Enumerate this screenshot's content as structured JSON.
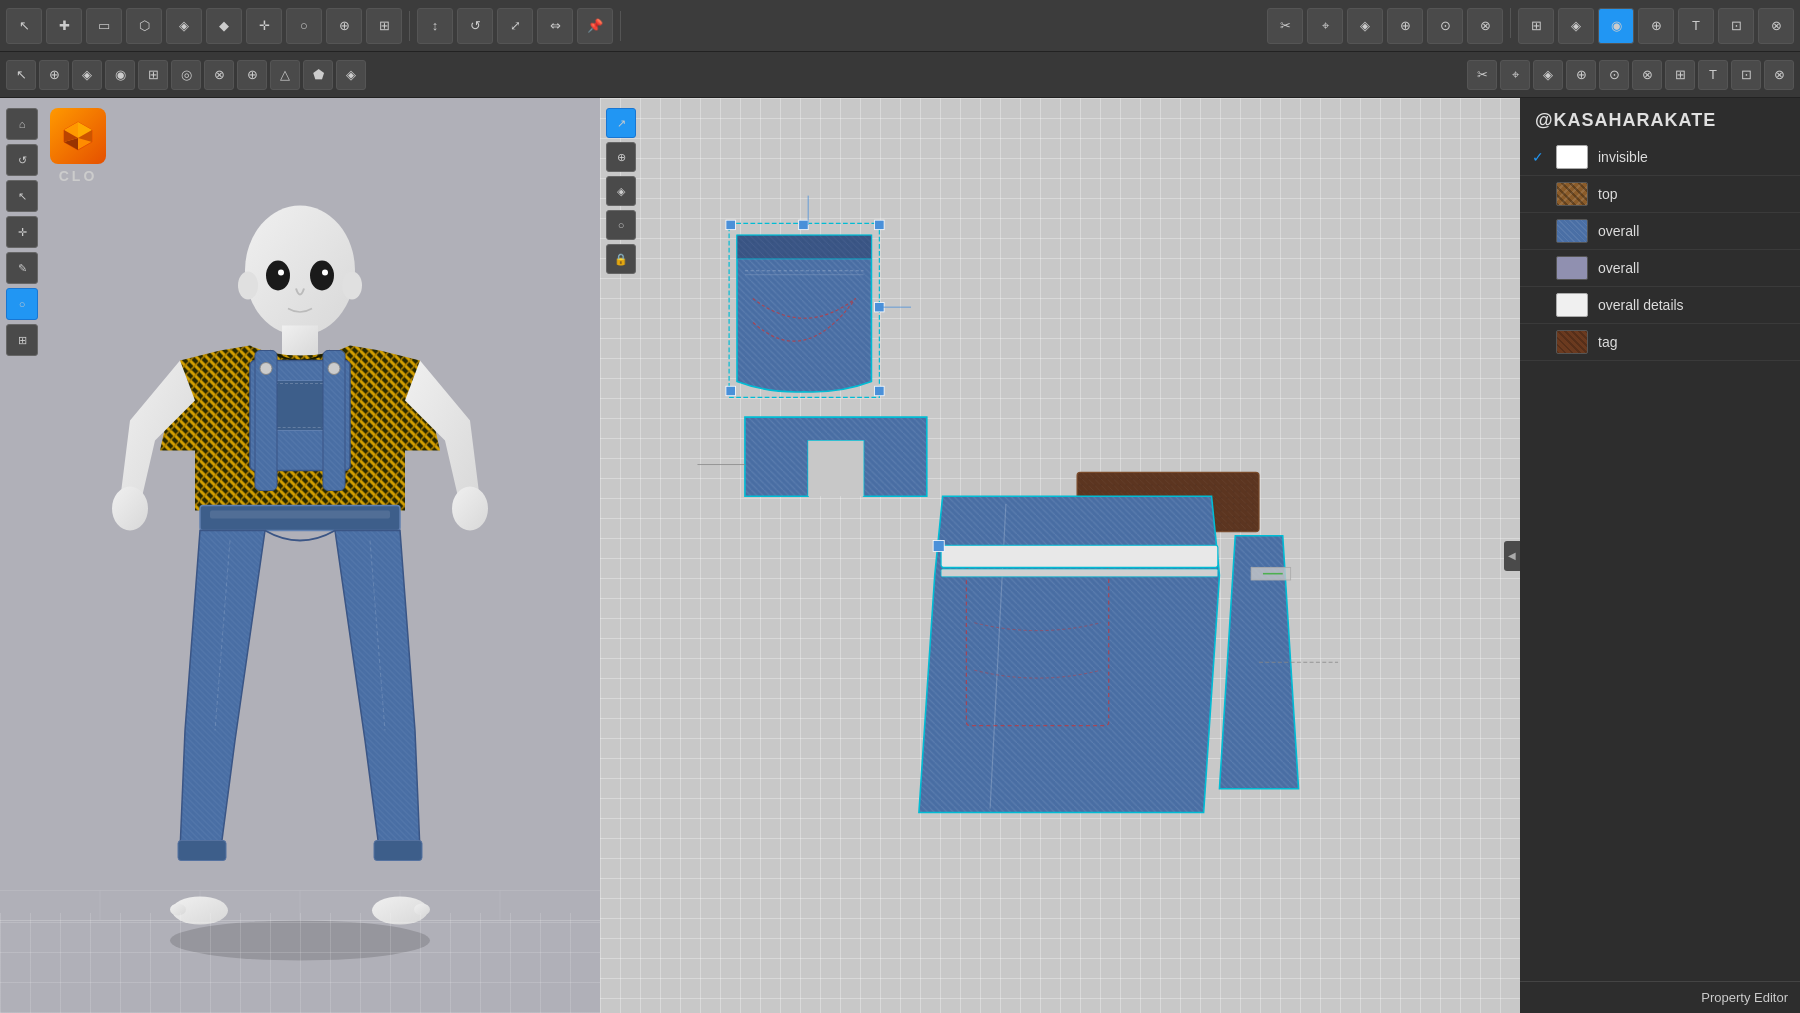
{
  "app": {
    "name": "CLO",
    "watermark": "@KASAHARAKATE"
  },
  "toolbar1": {
    "buttons": [
      "⬡",
      "✚",
      "▣",
      "◈",
      "⬟",
      "◎",
      "❖",
      "◉",
      "⊕",
      "⊗",
      "⬡",
      "◈",
      "⊙",
      "⊕",
      "◎",
      "▲",
      "◈",
      "⊡",
      "◉",
      "◈",
      "⊗",
      "◎",
      "◈",
      "◉"
    ]
  },
  "toolbar2": {
    "buttons": [
      "◈",
      "⬡",
      "◉",
      "⊕",
      "◎",
      "⊗",
      "▣",
      "⬟",
      "⊙",
      "◈",
      "⊕",
      "⊗",
      "◎",
      "▲",
      "◉",
      "◈",
      "⊡",
      "◉",
      "◈",
      "⊗"
    ]
  },
  "leftTools": [
    "⊕",
    "◈",
    "◉",
    "⊙",
    "⬟",
    "◈",
    "⊗"
  ],
  "tools2d": [
    {
      "icon": "↗",
      "active": true
    },
    {
      "icon": "⊕",
      "active": false
    },
    {
      "icon": "◈",
      "active": false
    },
    {
      "icon": "◉",
      "active": false
    },
    {
      "icon": "🔒",
      "active": false
    }
  ],
  "clo": {
    "logoText": "◆",
    "label": "CLO"
  },
  "layers": [
    {
      "name": "invisible",
      "swatchColor": "#ffffff",
      "checked": true,
      "swatchType": "solid"
    },
    {
      "name": "top",
      "swatchColor": "#8b5c2a",
      "checked": false,
      "swatchType": "pattern"
    },
    {
      "name": "overall",
      "swatchColor": "#4a6fa5",
      "checked": false,
      "swatchType": "solid"
    },
    {
      "name": "overall",
      "swatchColor": "#9090b0",
      "checked": false,
      "swatchType": "solid"
    },
    {
      "name": "overall details",
      "swatchColor": "#f0f0f0",
      "checked": false,
      "swatchType": "solid"
    },
    {
      "name": "tag",
      "swatchColor": "#6b3a1f",
      "checked": false,
      "swatchType": "pattern"
    }
  ],
  "propertyEditor": {
    "label": "Property Editor"
  }
}
